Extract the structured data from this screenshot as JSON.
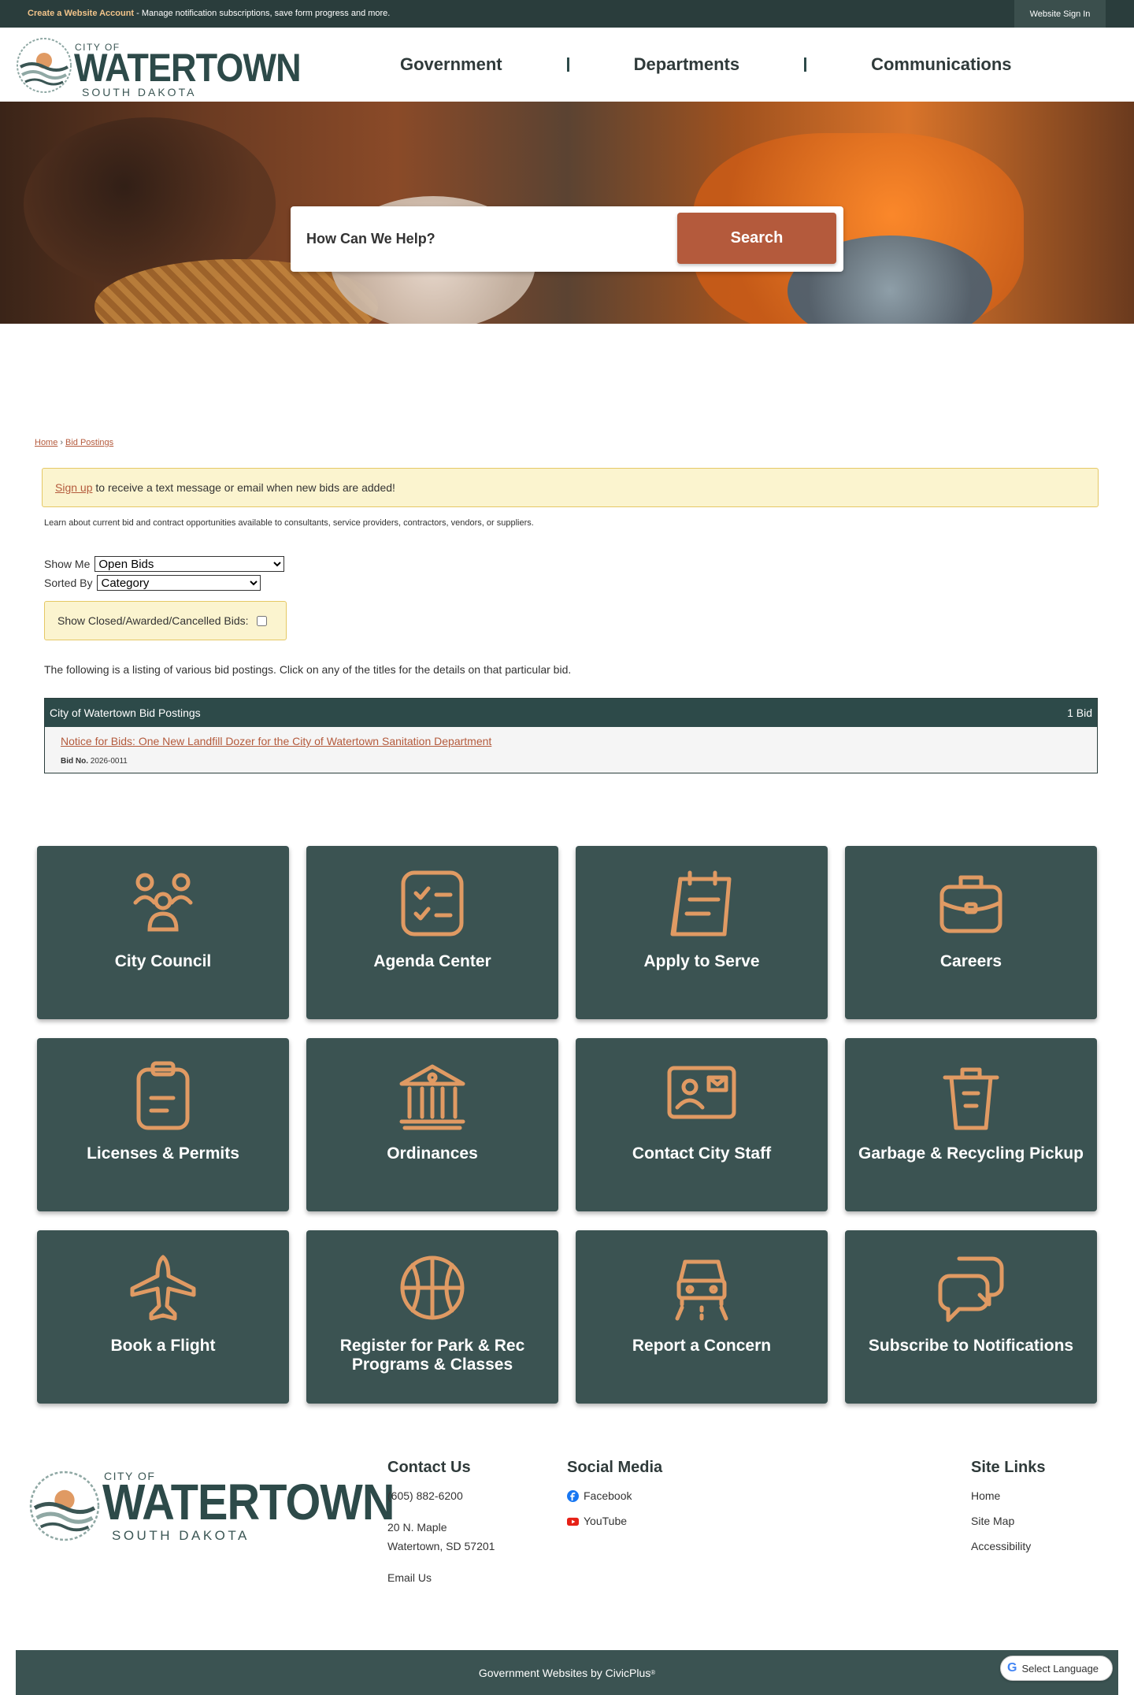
{
  "topbar": {
    "notice_bold": "Create a Website Account",
    "notice_text": " - Manage notification subscriptions, save form progress and more.",
    "signin": "Website Sign In"
  },
  "logo": {
    "city_of": "CITY OF",
    "name": "WATERTOWN",
    "state": "SOUTH DAKOTA"
  },
  "nav": {
    "items": [
      "Government",
      "Departments",
      "Communications"
    ]
  },
  "search": {
    "placeholder": "How Can We Help?",
    "button": "Search"
  },
  "breadcrumb": [
    "Home",
    "Bid Postings"
  ],
  "alert": {
    "link": "Sign up",
    "text": " to receive a text message or email when new bids are added!"
  },
  "intro": "Learn about current bid and contract opportunities available to consultants, service providers, contractors, vendors, or suppliers.",
  "filters": {
    "show_me_label": "Show Me",
    "show_me_value": "Open Bids",
    "sorted_by_label": "Sorted By",
    "sorted_by_value": "Category",
    "closed_label": "Show Closed/Awarded/Cancelled Bids:"
  },
  "listing_text": "The following is a listing of various bid postings. Click on any of the titles for the details on that particular bid.",
  "bid_table": {
    "title": "City of Watertown Bid Postings",
    "count": "1 Bid",
    "bids": [
      {
        "title": "Notice for Bids: One New Landfill Dozer for the City of Watertown Sanitation Department",
        "number_label": "Bid No.",
        "number": "2026-0011"
      }
    ]
  },
  "tiles": [
    {
      "label": "City Council",
      "icon": "people-icon"
    },
    {
      "label": "Agenda Center",
      "icon": "checklist-icon"
    },
    {
      "label": "Apply to Serve",
      "icon": "calendar-form-icon"
    },
    {
      "label": "Careers",
      "icon": "briefcase-icon"
    },
    {
      "label": "Licenses & Permits",
      "icon": "clipboard-icon"
    },
    {
      "label": "Ordinances",
      "icon": "government-building-icon"
    },
    {
      "label": "Contact City Staff",
      "icon": "contact-card-icon"
    },
    {
      "label": "Garbage & Recycling Pickup",
      "icon": "trash-can-icon"
    },
    {
      "label": "Book a Flight",
      "icon": "airplane-icon"
    },
    {
      "label": "Register for Park & Rec Programs & Classes",
      "icon": "basketball-icon"
    },
    {
      "label": "Report a Concern",
      "icon": "car-road-icon"
    },
    {
      "label": "Subscribe to Notifications",
      "icon": "chat-bubbles-icon"
    }
  ],
  "footer": {
    "contact": {
      "heading": "Contact Us",
      "phone": "(605) 882-6200",
      "address1": "20 N. Maple",
      "address2": "Watertown, SD 57201",
      "email": "Email Us"
    },
    "social": {
      "heading": "Social Media",
      "facebook": "Facebook",
      "youtube": "YouTube"
    },
    "site_links": {
      "heading": "Site Links",
      "items": [
        "Home",
        "Site Map",
        "Accessibility"
      ]
    },
    "bottom": "Government Websites by CivicPlus",
    "bottom_mark": "®",
    "language": "Select Language"
  },
  "colors": {
    "teal_dark": "#2d4a49",
    "tile": "#3b5352",
    "accent": "#b45a3c",
    "icon_orange": "#e09a63",
    "alert_bg": "#fbf4cf"
  }
}
